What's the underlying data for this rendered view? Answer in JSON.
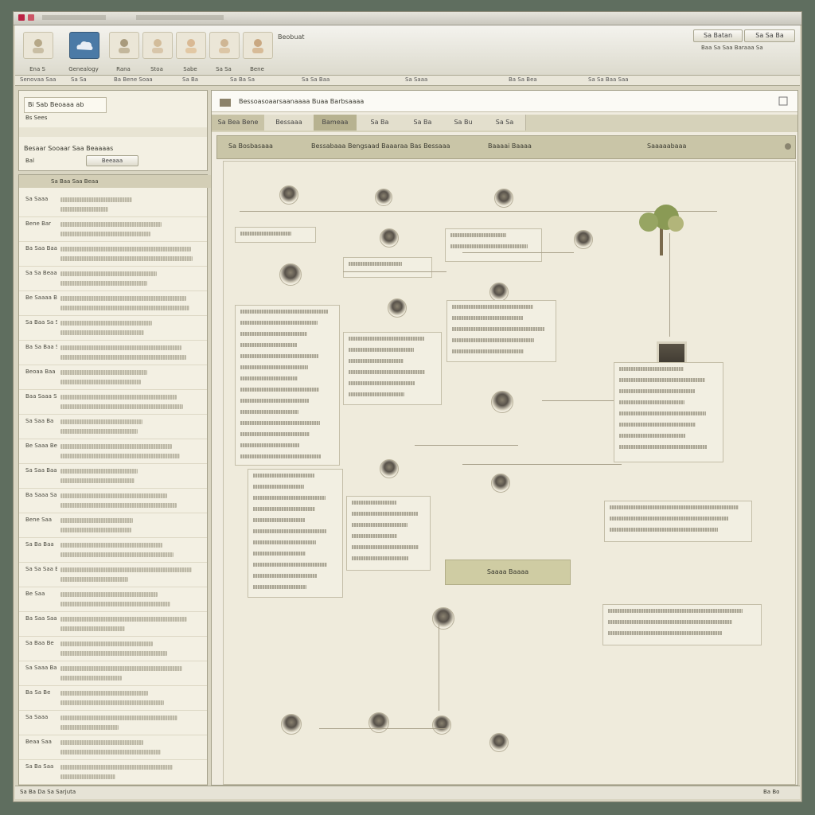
{
  "window": {
    "title": "",
    "status": "Sa Ba Da Sa Sarjuta",
    "zoom": "Ba Bo"
  },
  "toolbar": {
    "buttons": [
      {
        "label": "Ena S",
        "icon": "person-icon"
      },
      {
        "label": "Genealogy",
        "icon": "cloud-icon"
      },
      {
        "label": "Rana",
        "icon": "person-icon"
      },
      {
        "label": "Stoa",
        "icon": "person-icon"
      },
      {
        "label": "Sabe",
        "icon": "person-icon"
      },
      {
        "label": "Sa Sa",
        "icon": "person-icon"
      },
      {
        "label": "Bene",
        "icon": "person-icon"
      }
    ],
    "name_label": "Beobuat",
    "right_buttons": [
      "Sa Batan",
      "Sa Sa Ba"
    ],
    "right_caption": "Baa Sa Saa Baraaa Sa"
  },
  "tabstrip": [
    "Senovaa Saa",
    "Sa Sa",
    "Ba Bene Soaa",
    "Sa Ba",
    "Sa Ba Sa",
    "Sa Sa Baa",
    "Sa Saaa",
    "Ba Sa Bea",
    "Sa Sa Baa Saa"
  ],
  "left_top": {
    "title": "Bi Sab Beoaaa ab",
    "subtitle": "Bs Sees",
    "line": "Besaar Sooaar Saa Beaaaas",
    "field_label": "Bal",
    "field_value": "Beeaaa"
  },
  "left_list": {
    "header": "Sa Baa Saa Beaa",
    "rows": [
      "Sa Saaa",
      "Bene Bar",
      "Ba Saa Baaa",
      "Sa Sa Beaaaa Saa",
      "Be Saaaa Bea",
      "Sa Baa Sa Sa",
      "Ba Sa Baa Saaa",
      "Beoaa Baa",
      "Baa Saaa Saaa",
      "Sa Saa Ba",
      "Be Saaa Beee",
      "Sa Saa Baaa Sa",
      "Ba Saaa Sa",
      "Bene Saa",
      "Sa Ba Baa",
      "Sa Sa Saa Baaa",
      "Be Saa",
      "Ba Saa Saaa",
      "Sa Baa Be",
      "Sa Saaa Baa",
      "Ba Sa Be",
      "Sa Saaa",
      "Beaa Saa",
      "Sa Ba Saa"
    ]
  },
  "chart": {
    "title": "Bessoasoaarsaanaaaa Buaa Barbsaaaa",
    "tabs": [
      "Sa Bea Bene",
      "Bessaaa",
      "Bameaa",
      "Sa Ba",
      "Sa Ba",
      "Sa Bu",
      "Sa Sa"
    ],
    "search_label": "Sa Bosbasaaa",
    "search_value": "Bessabaaa Bengsaad Baaaraa Bas Bessaaa",
    "field2": "Baaaai Baaaa",
    "field3": "Saaaaabaaa",
    "highlight_box": "Saaaa Baaaa"
  }
}
